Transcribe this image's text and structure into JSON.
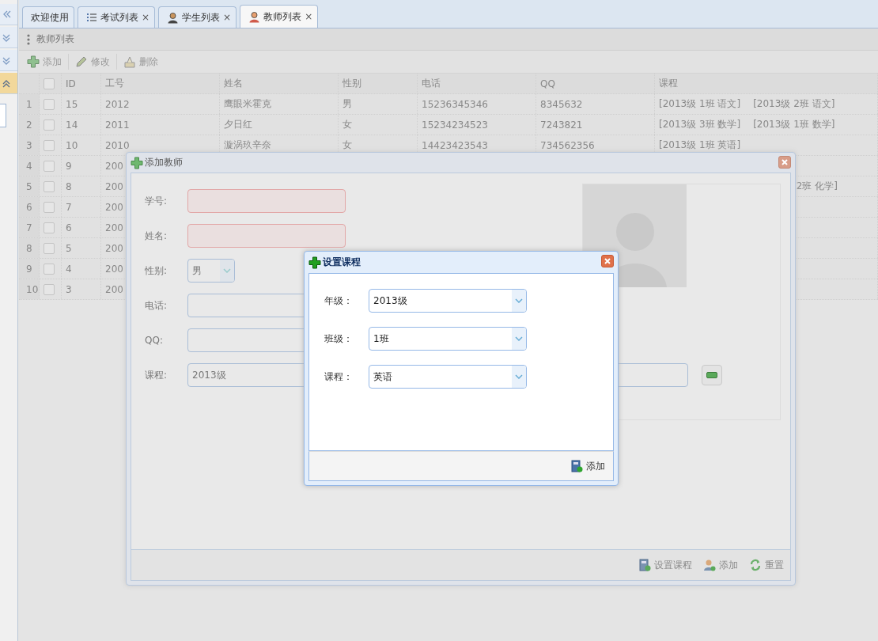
{
  "sidebar": {
    "buttons": [
      {
        "kind": "double-left",
        "selected": false
      },
      {
        "kind": "double-down",
        "selected": false
      },
      {
        "kind": "double-down",
        "selected": false
      },
      {
        "kind": "double-up",
        "selected": true
      }
    ]
  },
  "tabs": [
    {
      "label": "欢迎使用",
      "kind": "plain",
      "selected": false
    },
    {
      "label": "考试列表",
      "kind": "list",
      "close": "×",
      "selected": false
    },
    {
      "label": "学生列表",
      "kind": "student",
      "close": "×",
      "selected": false
    },
    {
      "label": "教师列表",
      "kind": "teacher",
      "close": "×",
      "selected": true
    }
  ],
  "panel": {
    "title": "教师列表"
  },
  "toolbar": [
    {
      "label": "添加",
      "kind": "add"
    },
    {
      "label": "修改",
      "kind": "edit"
    },
    {
      "label": "删除",
      "kind": "delete"
    }
  ],
  "table": {
    "header_checked": false,
    "columns": [
      "ID",
      "工号",
      "姓名",
      "性别",
      "电话",
      "QQ",
      "课程"
    ],
    "rows": [
      {
        "number": "1",
        "checked": false,
        "id": "15",
        "job_no": "2012",
        "name": "鹰眼米霍克",
        "gender": "男",
        "phone": "15236345346",
        "qq": "8345632",
        "courses": [
          "[2013级 1班 语文]",
          "[2013级 2班 语文]"
        ]
      },
      {
        "number": "2",
        "checked": false,
        "id": "14",
        "job_no": "2011",
        "name": "夕日红",
        "gender": "女",
        "phone": "15234234523",
        "qq": "7243821",
        "courses": [
          "[2013级 3班 数学]",
          "[2013级 1班 数学]"
        ]
      },
      {
        "number": "3",
        "checked": false,
        "id": "10",
        "job_no": "2010",
        "name": "漩涡玖辛奈",
        "gender": "女",
        "phone": "14423423543",
        "qq": "734562356",
        "courses": [
          "[2013级 1班 英语]"
        ]
      },
      {
        "number": "4",
        "checked": false,
        "id": "9",
        "job_no": "200"
      },
      {
        "number": "5",
        "checked": false,
        "id": "8",
        "job_no": "200",
        "courses": [
          "2班 化学]"
        ],
        "courses_cut_left": true
      },
      {
        "number": "6",
        "checked": false,
        "id": "7",
        "job_no": "200"
      },
      {
        "number": "7",
        "checked": false,
        "id": "6",
        "job_no": "200"
      },
      {
        "number": "8",
        "checked": false,
        "id": "5",
        "job_no": "200"
      },
      {
        "number": "9",
        "checked": false,
        "id": "4",
        "job_no": "200"
      },
      {
        "number": "10",
        "checked": false,
        "id": "3",
        "job_no": "200"
      }
    ]
  },
  "add_teacher_dialog": {
    "title": "添加教师",
    "fields": [
      {
        "label": "学号:",
        "kind": "text",
        "invalid": true
      },
      {
        "label": "姓名:",
        "kind": "text",
        "invalid": true
      },
      {
        "label": "性别:",
        "kind": "combo",
        "value": "男"
      },
      {
        "label": "电话:",
        "kind": "text",
        "invalid": false
      },
      {
        "label": "QQ:",
        "kind": "text",
        "invalid": false
      },
      {
        "label": "课程:",
        "kind": "course",
        "value": "2013级"
      }
    ],
    "buttons": [
      {
        "label": "设置课程",
        "kind": "book-add"
      },
      {
        "label": "添加",
        "kind": "user-add"
      },
      {
        "label": "重置",
        "kind": "reset"
      }
    ]
  },
  "course_dialog": {
    "title": "设置课程",
    "fields": [
      {
        "label": "年级：",
        "value": "2013级"
      },
      {
        "label": "班级：",
        "value": "1班"
      },
      {
        "label": "课程：",
        "value": "英语"
      }
    ],
    "buttons": [
      {
        "label": "添加",
        "kind": "book-add"
      }
    ]
  }
}
